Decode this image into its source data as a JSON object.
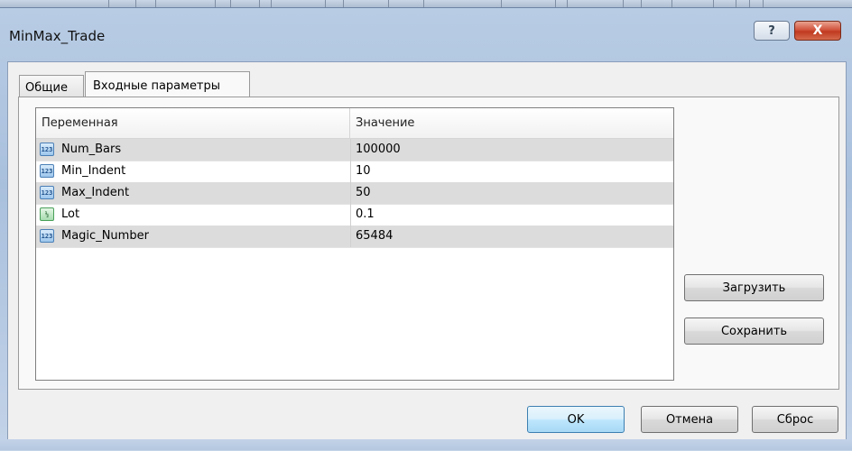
{
  "window": {
    "title": "MinMax_Trade",
    "help_label": "?",
    "close_label": "X"
  },
  "tabs": [
    {
      "label": "Общие",
      "active": false
    },
    {
      "label": "Входные параметры",
      "active": true
    }
  ],
  "grid": {
    "columns": [
      "Переменная",
      "Значение"
    ],
    "rows": [
      {
        "icon": "integer-icon",
        "icon_text": "123",
        "name": "Num_Bars",
        "value": "100000"
      },
      {
        "icon": "integer-icon",
        "icon_text": "123",
        "name": "Min_Indent",
        "value": "10"
      },
      {
        "icon": "integer-icon",
        "icon_text": "123",
        "name": "Max_Indent",
        "value": "50"
      },
      {
        "icon": "double-icon",
        "icon_text": "½",
        "name": "Lot",
        "value": "0.1"
      },
      {
        "icon": "integer-icon",
        "icon_text": "123",
        "name": "Magic_Number",
        "value": "65484"
      }
    ]
  },
  "buttons": {
    "load": "Загрузить",
    "save": "Сохранить",
    "ok": "OK",
    "cancel": "Отмена",
    "reset": "Сброс"
  }
}
